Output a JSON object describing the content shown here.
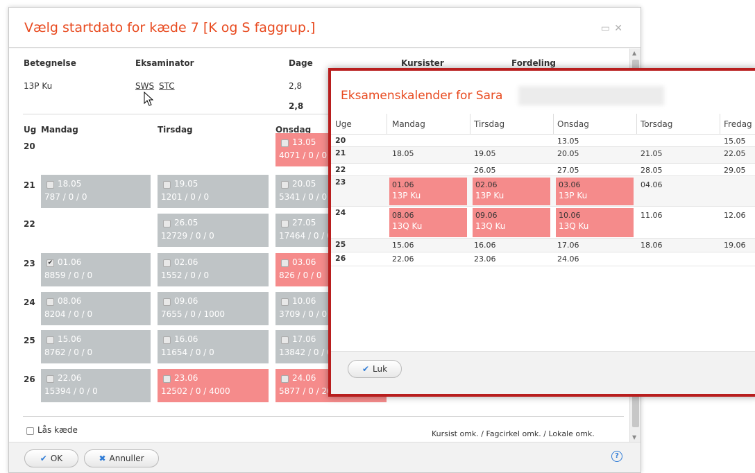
{
  "main_dialog": {
    "title": "Vælg startdato for kæde 7 [K og S faggrup.]",
    "headers": {
      "betegnelse": "Betegnelse",
      "eksaminator": "Eksaminator",
      "dage": "Dage",
      "kursister": "Kursister",
      "fordeling": "Fordeling"
    },
    "row": {
      "betegnelse": "13P Ku",
      "eksaminator1": "SWS",
      "eksaminator2": "STC",
      "dage": "2,8",
      "dage_total": "2,8"
    },
    "day_headers": {
      "ug": "Ug",
      "mandag": "Mandag",
      "tirsdag": "Tirsdag",
      "onsdag": "Onsdag"
    },
    "weeks": [
      {
        "week": "20",
        "mon": null,
        "tue": null,
        "wed": {
          "date": "13.05",
          "stats": "4071 / 0 / 0",
          "state": "red",
          "checked": false
        }
      },
      {
        "week": "21",
        "mon": {
          "date": "18.05",
          "stats": "787 / 0 / 0",
          "state": "grey",
          "checked": false
        },
        "tue": {
          "date": "19.05",
          "stats": "1201 / 0 / 0",
          "state": "grey",
          "checked": false
        },
        "wed": {
          "date": "20.05",
          "stats": "5341 / 0 / 0",
          "state": "grey",
          "checked": false
        }
      },
      {
        "week": "22",
        "mon": null,
        "tue": {
          "date": "26.05",
          "stats": "12729 / 0 / 0",
          "state": "grey",
          "checked": false
        },
        "wed": {
          "date": "27.05",
          "stats": "17464 / 0 / 0",
          "state": "grey",
          "checked": false
        }
      },
      {
        "week": "23",
        "mon": {
          "date": "01.06",
          "stats": "8859 / 0 / 0",
          "state": "grey",
          "checked": true
        },
        "tue": {
          "date": "02.06",
          "stats": "1552 / 0 / 0",
          "state": "grey",
          "checked": false
        },
        "wed": {
          "date": "03.06",
          "stats": "826 / 0 / 0",
          "state": "red",
          "checked": false
        }
      },
      {
        "week": "24",
        "mon": {
          "date": "08.06",
          "stats": "8204 / 0 / 0",
          "state": "grey",
          "checked": false
        },
        "tue": {
          "date": "09.06",
          "stats": "7655 / 0 / 1000",
          "state": "grey",
          "checked": false
        },
        "wed": {
          "date": "10.06",
          "stats": "3709 / 0 / 0",
          "state": "grey",
          "checked": false
        }
      },
      {
        "week": "25",
        "mon": {
          "date": "15.06",
          "stats": "8762 / 0 / 0",
          "state": "grey",
          "checked": false
        },
        "tue": {
          "date": "16.06",
          "stats": "11654 / 0 / 0",
          "state": "grey",
          "checked": false
        },
        "wed": {
          "date": "17.06",
          "stats": "13842 / 0 / 0",
          "state": "grey",
          "checked": false
        }
      },
      {
        "week": "26",
        "mon": {
          "date": "22.06",
          "stats": "15394 / 0 / 0",
          "state": "grey",
          "checked": false
        },
        "tue": {
          "date": "23.06",
          "stats": "12502 / 0 / 4000",
          "state": "red",
          "checked": false
        },
        "wed": {
          "date": "24.06",
          "stats": "5877 / 0 / 2000",
          "state": "red",
          "checked": false
        }
      }
    ],
    "lock_label": "Lås kæde",
    "legend": "Kursist omk. / Fagcirkel omk. / Lokale omk.",
    "ok_label": "OK",
    "cancel_label": "Annuller",
    "help": "?"
  },
  "calendar_dialog": {
    "title": "Eksamenskalender for Sara",
    "columns": [
      "Uge",
      "Mandag",
      "Tirsdag",
      "Onsdag",
      "Torsdag",
      "Fredag"
    ],
    "rows": [
      {
        "week": "20",
        "cells": [
          "",
          "",
          "13.05",
          "",
          "15.05"
        ]
      },
      {
        "week": "21",
        "cells": [
          "18.05",
          "19.05",
          "20.05",
          "21.05",
          "22.05"
        ]
      },
      {
        "week": "22",
        "cells": [
          "",
          "26.05",
          "27.05",
          "28.05",
          "29.05"
        ]
      },
      {
        "week": "23",
        "cells": [
          "01.06|13P Ku",
          "02.06|13P Ku",
          "03.06|13P Ku",
          "04.06",
          ""
        ]
      },
      {
        "week": "24",
        "cells": [
          "08.06|13Q Ku",
          "09.06|13Q Ku",
          "10.06|13Q Ku",
          "11.06",
          "12.06"
        ]
      },
      {
        "week": "25",
        "cells": [
          "15.06",
          "16.06",
          "17.06",
          "18.06",
          "19.06"
        ]
      },
      {
        "week": "26",
        "cells": [
          "22.06",
          "23.06",
          "24.06",
          "",
          ""
        ]
      }
    ],
    "close_label": "Luk"
  },
  "colors": {
    "accent": "#e84a1f",
    "booked": "#f58b8b",
    "available": "#bfc4c6",
    "frame": "#b81e1e"
  }
}
